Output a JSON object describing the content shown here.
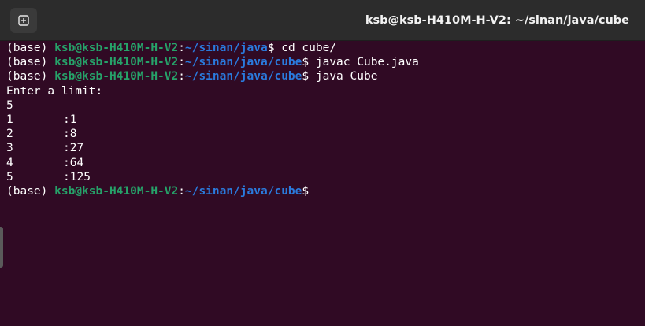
{
  "window": {
    "title": "ksb@ksb-H410M-H-V2: ~/sinan/java/cube",
    "new_tab_icon": "new-tab-icon"
  },
  "terminal": {
    "prompts": [
      {
        "env": "(base) ",
        "userhost": "ksb@ksb-H410M-H-V2",
        "sep": ":",
        "path": "~/sinan/java",
        "dollar": "$ ",
        "command": "cd cube/"
      },
      {
        "env": "(base) ",
        "userhost": "ksb@ksb-H410M-H-V2",
        "sep": ":",
        "path": "~/sinan/java/cube",
        "dollar": "$ ",
        "command": "javac Cube.java"
      },
      {
        "env": "(base) ",
        "userhost": "ksb@ksb-H410M-H-V2",
        "sep": ":",
        "path": "~/sinan/java/cube",
        "dollar": "$ ",
        "command": "java Cube"
      }
    ],
    "output_prompt": "Enter a limit:",
    "input_value": "5",
    "results": [
      {
        "n": "1",
        "cube": ":1"
      },
      {
        "n": "2",
        "cube": ":8"
      },
      {
        "n": "3",
        "cube": ":27"
      },
      {
        "n": "4",
        "cube": ":64"
      },
      {
        "n": "5",
        "cube": ":125"
      }
    ],
    "final_prompt": {
      "env": "(base) ",
      "userhost": "ksb@ksb-H410M-H-V2",
      "sep": ":",
      "path": "~/sinan/java/cube",
      "dollar": "$"
    }
  },
  "colors": {
    "background": "#300a24",
    "user_host": "#26a269",
    "path": "#2a7bde",
    "titlebar": "#2c2c2c"
  }
}
